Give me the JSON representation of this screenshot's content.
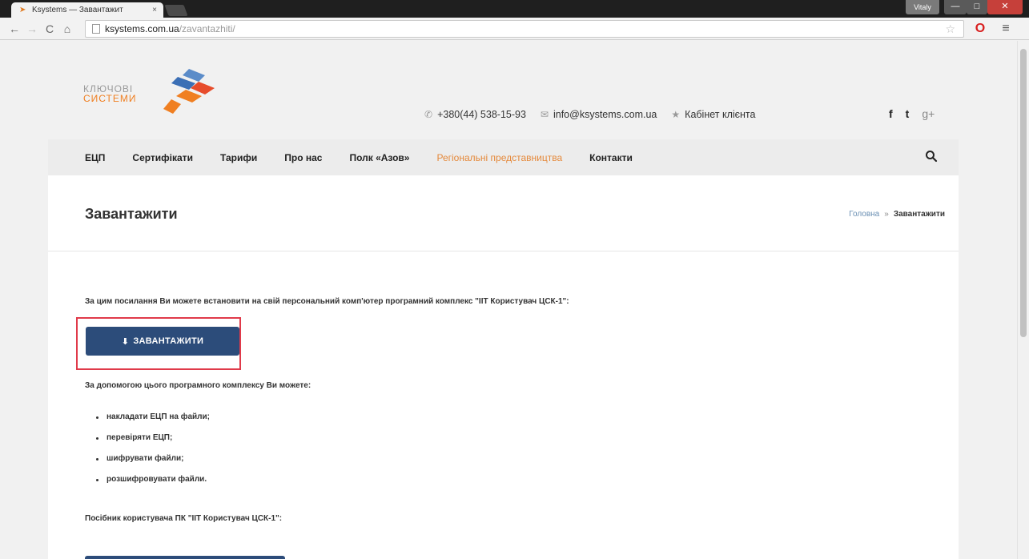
{
  "browser": {
    "tab_title": "Ksystems — Завантажит",
    "tab_close": "×",
    "window_user": "Vitaly",
    "min_glyph": "—",
    "max_glyph": "□",
    "close_glyph": "✕",
    "url_host": "ksystems.com.ua",
    "url_path": "/zavantazhiti/"
  },
  "logo": {
    "line1": "КЛЮЧОВІ",
    "line2": "СИСТЕМИ",
    "colors": [
      "#5b8cc9",
      "#3b6fb5",
      "#e74c2b",
      "#f07f21"
    ]
  },
  "header": {
    "phone": "+380(44) 538-15-93",
    "email": "info@ksystems.com.ua",
    "cabinet": "Кабінет клієнта",
    "social": {
      "facebook": "f",
      "twitter": "t",
      "gplus": "g+"
    }
  },
  "nav": {
    "items": [
      {
        "label": "ЕЦП",
        "active": false
      },
      {
        "label": "Сертифікати",
        "active": false
      },
      {
        "label": "Тарифи",
        "active": false
      },
      {
        "label": "Про нас",
        "active": false
      },
      {
        "label": "Полк «Азов»",
        "active": false
      },
      {
        "label": "Регіональні представництва",
        "active": true
      },
      {
        "label": "Контакти",
        "active": false
      }
    ]
  },
  "page": {
    "title": "Завантажити",
    "breadcrumb": {
      "home": "Головна",
      "separator": "»",
      "current": "Завантажити"
    }
  },
  "content": {
    "intro": "За цим посилання Ви можете встановити на свій персональний комп'ютер програмний комплекс \"ІІТ Користувач ЦСК-1\":",
    "download_label": "ЗАВАНТАЖИТИ",
    "can_title": "За допомогою цього програмного комплексу Ви можете:",
    "features": [
      "накладати ЕЦП на файли;",
      "перевіряти ЕЦП;",
      "шифрувати файли;",
      "розшифровувати файли."
    ],
    "manual_title": "Посібник користувача ПК \"ІІТ Користувач ЦСК-1\":"
  },
  "colors": {
    "accent_orange": "#e5893b",
    "button_blue": "#2c4c7a",
    "highlight_red": "#e03a4a"
  }
}
